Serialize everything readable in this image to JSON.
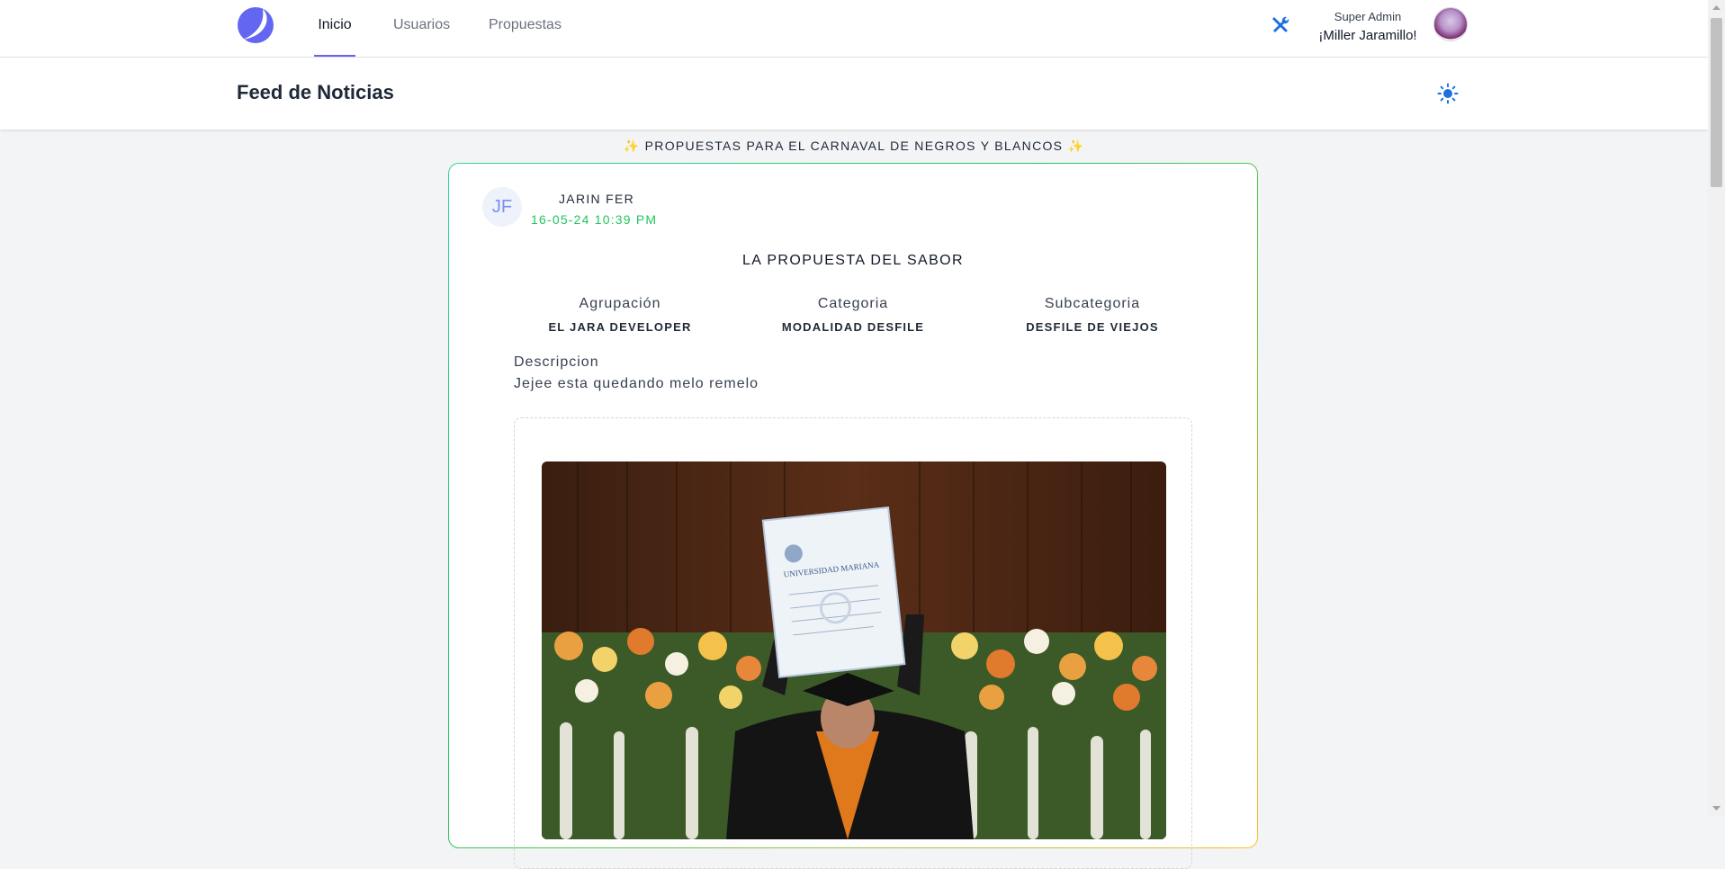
{
  "nav": {
    "tabs": [
      {
        "label": "Inicio",
        "active": true
      },
      {
        "label": "Usuarios",
        "active": false
      },
      {
        "label": "Propuestas",
        "active": false
      }
    ],
    "user_role": "Super Admin",
    "user_greeting": "¡Miller Jaramillo!"
  },
  "header": {
    "title": "Feed de Noticias",
    "theme_icon": "sun-icon"
  },
  "feed": {
    "banner": "✨ PROPUESTAS PARA EL CARNAVAL DE NEGROS Y BLANCOS ✨",
    "post": {
      "author_initials": "JF",
      "author": "JARIN FER",
      "date": "16-05-24 10:39 PM",
      "title": "LA PROPUESTA DEL SABOR",
      "meta": [
        {
          "label": "Agrupación",
          "value": "EL JARA DEVELOPER"
        },
        {
          "label": "Categoria",
          "value": "MODALIDAD DESFILE"
        },
        {
          "label": "Subcategoria",
          "value": "DESFILE DE VIEJOS"
        }
      ],
      "description_label": "Descripcion",
      "description": "Jejee esta quedando melo remelo",
      "diploma_text": "UNIVERSIDAD MARIANA"
    }
  },
  "colors": {
    "accent": "#6366f1",
    "brand_blue": "#1d6fe0",
    "date_green": "#22c55e",
    "card_border_start": "#34d399",
    "card_border_end": "#fbbf24"
  }
}
